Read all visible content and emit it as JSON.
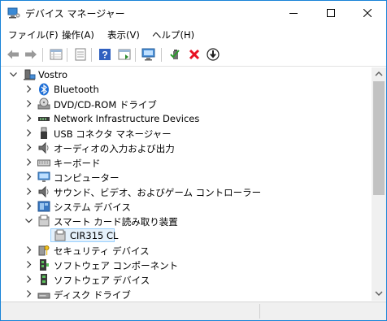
{
  "window": {
    "title": "デバイス マネージャー"
  },
  "menu": [
    {
      "label": "ファイル(F)"
    },
    {
      "label": "操作(A)"
    },
    {
      "label": "表示(V)"
    },
    {
      "label": "ヘルプ(H)"
    }
  ],
  "toolbar": {
    "buttons": [
      "back-arrow-icon",
      "forward-arrow-icon",
      "properties-grid-icon",
      "device-list-icon",
      "help-icon",
      "update-driver-icon",
      "monitor-scan-icon",
      "enable-device-icon",
      "uninstall-x-icon",
      "download-arrow-icon"
    ]
  },
  "tree": {
    "root": {
      "label": "Vostro",
      "expanded": true
    },
    "categories": [
      {
        "label": "Bluetooth",
        "icon": "bluetooth-icon",
        "expanded": false
      },
      {
        "label": "DVD/CD-ROM ドライブ",
        "icon": "dvd-drive-icon",
        "expanded": false
      },
      {
        "label": "Network Infrastructure Devices",
        "icon": "network-device-icon",
        "expanded": false
      },
      {
        "label": "USB コネクタ マネージャー",
        "icon": "usb-connector-icon",
        "expanded": false
      },
      {
        "label": "オーディオの入力および出力",
        "icon": "speaker-icon",
        "expanded": false
      },
      {
        "label": "キーボード",
        "icon": "keyboard-icon",
        "expanded": false
      },
      {
        "label": "コンピューター",
        "icon": "computer-monitor-icon",
        "expanded": false
      },
      {
        "label": "サウンド、ビデオ、およびゲーム コントローラー",
        "icon": "speaker-icon",
        "expanded": false
      },
      {
        "label": "システム デバイス",
        "icon": "system-device-icon",
        "expanded": false
      },
      {
        "label": "スマート カード読み取り装置",
        "icon": "smart-card-reader-icon",
        "expanded": true,
        "children": [
          {
            "label": "CIR315 CL",
            "icon": "card-reader-icon",
            "selected": true
          }
        ]
      },
      {
        "label": "セキュリティ デバイス",
        "icon": "security-key-icon",
        "expanded": false
      },
      {
        "label": "ソフトウェア コンポーネント",
        "icon": "software-component-icon",
        "expanded": false
      },
      {
        "label": "ソフトウェア デバイス",
        "icon": "software-device-icon",
        "expanded": false
      },
      {
        "label": "ディスク ドライブ",
        "icon": "disk-drive-icon",
        "expanded": false
      }
    ]
  },
  "colors": {
    "accent": "#1883d7",
    "selection": "#e5f1fb",
    "selection_border": "#99d1ff",
    "delete_red": "#e81123",
    "help_blue": "#3060c0"
  }
}
